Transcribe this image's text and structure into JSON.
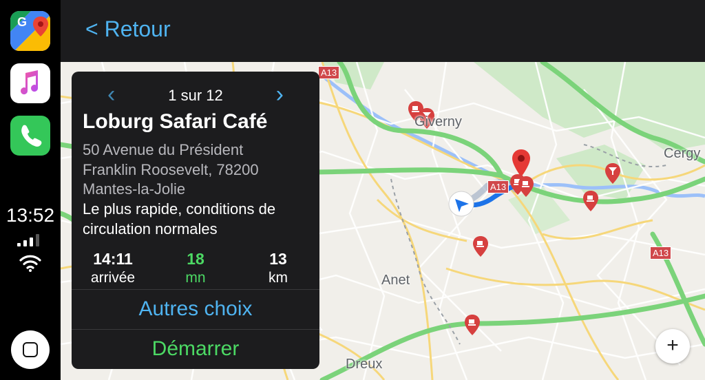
{
  "sidebar": {
    "apps": [
      {
        "name": "google-maps-app-icon"
      },
      {
        "name": "music-app-icon"
      },
      {
        "name": "phone-app-icon"
      }
    ],
    "time": "13:52"
  },
  "header": {
    "back_label": "< Retour"
  },
  "map": {
    "labels": {
      "giverny": "Giverny",
      "anet": "Anet",
      "cergy": "Cergy",
      "dreux": "Dreux"
    },
    "road_badges": {
      "a13_top": "A13",
      "a13_center": "A13",
      "a13_right": "A13"
    },
    "zoom_in": "+"
  },
  "card": {
    "pager": {
      "prev": "‹",
      "count": "1 sur 12",
      "next": "›"
    },
    "place_name": "Loburg Safari Café",
    "address_line1": "50 Avenue du Président",
    "address_line2": "Franklin Roosevelt, 78200",
    "address_line3": "Mantes-la-Jolie",
    "route_line1": "Le plus rapide, conditions de",
    "route_line2": "circulation normales",
    "arrival": {
      "value": "14:11",
      "unit": "arrivée"
    },
    "duration": {
      "value": "18",
      "unit": "mn"
    },
    "distance": {
      "value": "13",
      "unit": "km"
    },
    "other_options": "Autres choix",
    "start": "Démarrer"
  },
  "colors": {
    "accent_blue": "#4fb3f0",
    "start_green": "#4cd964",
    "duration_green": "#4cd964",
    "poi_red": "#d6403f"
  }
}
